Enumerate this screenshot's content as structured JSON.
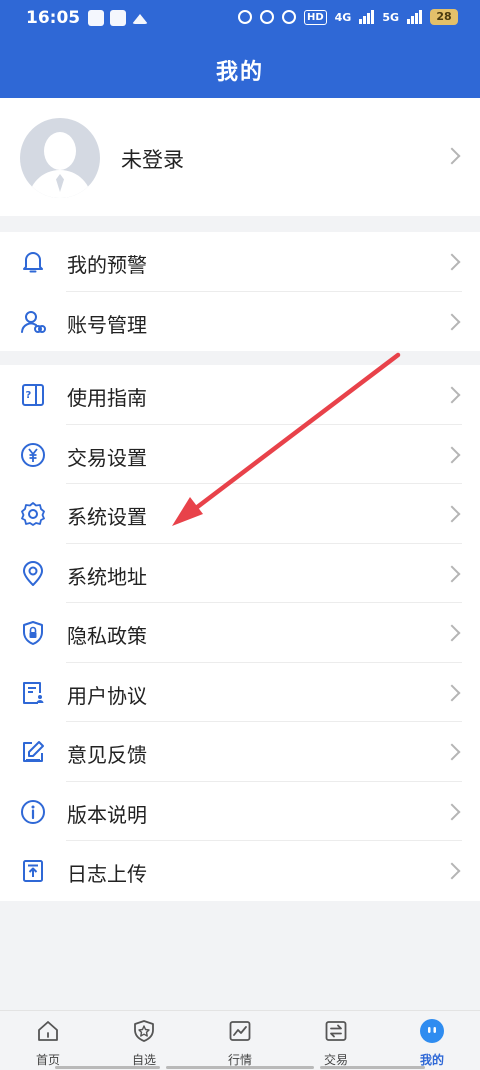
{
  "status_bar": {
    "time": "16:05",
    "hd_badge": "HD",
    "network_1": "4G",
    "network_2": "5G",
    "battery": "28"
  },
  "header": {
    "title": "我的"
  },
  "profile": {
    "label": "未登录"
  },
  "group1": [
    {
      "label": "我的预警",
      "icon": "bell-icon"
    },
    {
      "label": "账号管理",
      "icon": "user-link-icon"
    }
  ],
  "group2": [
    {
      "label": "使用指南",
      "icon": "guide-icon"
    },
    {
      "label": "交易设置",
      "icon": "yen-icon"
    },
    {
      "label": "系统设置",
      "icon": "gear-icon"
    },
    {
      "label": "系统地址",
      "icon": "location-icon"
    },
    {
      "label": "隐私政策",
      "icon": "shield-lock-icon"
    },
    {
      "label": "用户协议",
      "icon": "document-user-icon"
    },
    {
      "label": "意见反馈",
      "icon": "edit-icon"
    },
    {
      "label": "版本说明",
      "icon": "info-icon"
    },
    {
      "label": "日志上传",
      "icon": "upload-file-icon"
    }
  ],
  "tabs": [
    {
      "label": "首页",
      "icon": "home-icon"
    },
    {
      "label": "自选",
      "icon": "star-shield-icon"
    },
    {
      "label": "行情",
      "icon": "chart-icon"
    },
    {
      "label": "交易",
      "icon": "swap-icon"
    },
    {
      "label": "我的",
      "icon": "face-icon"
    }
  ],
  "colors": {
    "accent": "#2f68d6",
    "annotation_arrow": "#e8424a"
  }
}
